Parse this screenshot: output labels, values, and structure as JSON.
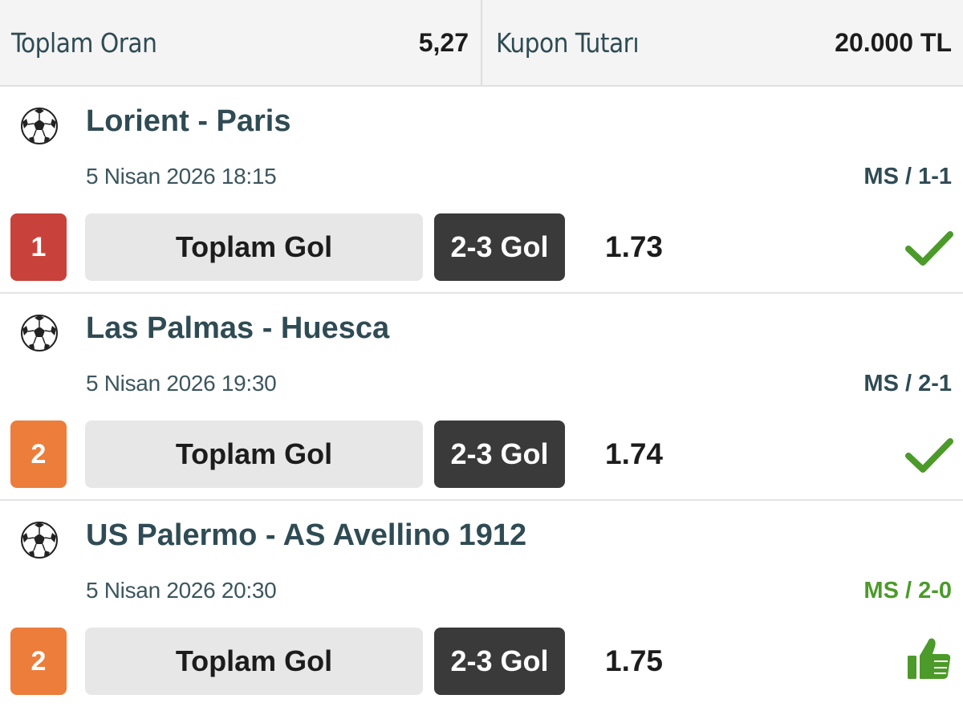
{
  "summary": {
    "total_odds_label": "Toplam Oran",
    "total_odds_value": "5,27",
    "coupon_amount_label": "Kupon Tutarı",
    "coupon_amount_value": "20.000 TL"
  },
  "events": [
    {
      "index": "1",
      "index_color": "red",
      "sport_icon": "soccer-ball-icon",
      "title": "Lorient - Paris",
      "datetime": "5 Nisan 2026 18:15",
      "result": "MS / 1-1",
      "result_color": "#2f4b54",
      "market": "Toplam Gol",
      "selection": "2-3 Gol",
      "odd": "1.73",
      "status_icon": "check-icon"
    },
    {
      "index": "2",
      "index_color": "orange",
      "sport_icon": "soccer-ball-icon",
      "title": "Las Palmas - Huesca",
      "datetime": "5 Nisan 2026 19:30",
      "result": "MS / 2-1",
      "result_color": "#2f4b54",
      "market": "Toplam Gol",
      "selection": "2-3 Gol",
      "odd": "1.74",
      "status_icon": "check-icon"
    },
    {
      "index": "2",
      "index_color": "orange",
      "sport_icon": "soccer-ball-icon",
      "title": "US Palermo - AS Avellino 1912",
      "datetime": "5 Nisan 2026 20:30",
      "result": "MS / 2-0",
      "result_color": "#4c9a2a",
      "market": "Toplam Gol",
      "selection": "2-3 Gol",
      "odd": "1.75",
      "status_icon": "thumbs-up-icon"
    }
  ],
  "colors": {
    "won_green": "#4c9a2a",
    "index_red": "#c8413a",
    "index_orange": "#ec7d3b",
    "title_teal": "#2f4b54"
  }
}
